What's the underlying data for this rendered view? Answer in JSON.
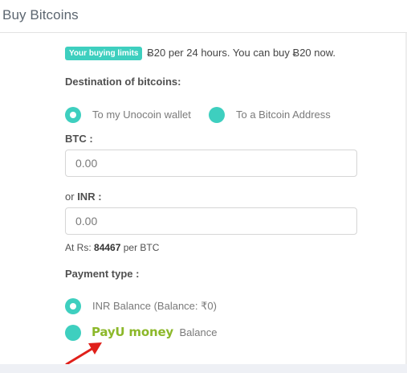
{
  "header": {
    "title": "Buy Bitcoins"
  },
  "limits": {
    "badge": "Your buying limits",
    "text": "Ƀ20 per 24 hours. You can buy Ƀ20 now."
  },
  "destination": {
    "label": "Destination of bitcoins:",
    "options": [
      {
        "label": "To my Unocoin wallet",
        "checked": true
      },
      {
        "label": "To a Bitcoin Address",
        "checked": false
      }
    ]
  },
  "btc": {
    "label": "BTC :",
    "placeholder": "0.00"
  },
  "inr": {
    "prefix": "or",
    "label": "INR :",
    "placeholder": "0.00"
  },
  "rate": {
    "prefix": "At Rs:",
    "value": "84467",
    "suffix": "per BTC"
  },
  "payment": {
    "label": "Payment type :",
    "options": [
      {
        "label": "INR Balance (Balance: ₹0)",
        "checked": true
      },
      {
        "logo_text": "PayU money",
        "label": "Balance",
        "checked": false
      }
    ]
  },
  "colors": {
    "accent": "#3ecfbf",
    "payu_green": "#8cb82a",
    "arrow": "#e0201a"
  },
  "icons": [
    "payumoney-logo-icon",
    "red-arrow-icon"
  ]
}
